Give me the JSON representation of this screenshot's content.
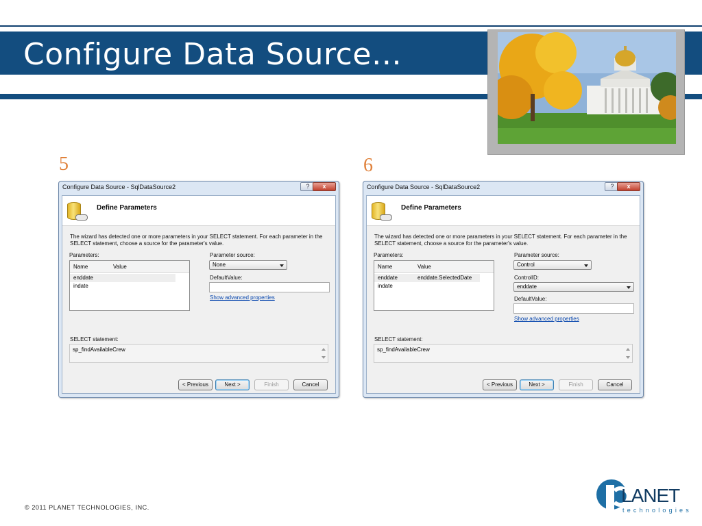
{
  "slide": {
    "title": "Configure Data Source…",
    "footer": "© 2011 PLANET TECHNOLOGIES, INC.",
    "logo": {
      "word": "LANET",
      "sub": "technologies"
    },
    "photo_icon": "photo-capitol-building"
  },
  "steps": [
    {
      "number": "5",
      "dialog": {
        "title": "Configure Data Source - SqlDataSource2",
        "help": "?",
        "close": "x",
        "heading": "Define Parameters",
        "description": "The wizard has detected one or more parameters in your SELECT statement. For each parameter in the SELECT statement, choose a source for the parameter's value.",
        "parameters_label": "Parameters:",
        "columns": [
          "Name",
          "Value"
        ],
        "rows": [
          {
            "name": "enddate",
            "value": ""
          },
          {
            "name": "indate",
            "value": ""
          }
        ],
        "parameter_source_label": "Parameter source:",
        "parameter_source_value": "None",
        "default_value_label": "DefaultValue:",
        "advanced_link": "Show advanced properties",
        "select_label": "SELECT statement:",
        "select_value": "sp_findAvailableCrew",
        "buttons": {
          "previous": "< Previous",
          "next": "Next >",
          "finish": "Finish",
          "cancel": "Cancel"
        }
      }
    },
    {
      "number": "6",
      "dialog": {
        "title": "Configure Data Source - SqlDataSource2",
        "help": "?",
        "close": "x",
        "heading": "Define Parameters",
        "description": "The wizard has detected one or more parameters in your SELECT statement. For each parameter in the SELECT statement, choose a source for the parameter's value.",
        "parameters_label": "Parameters:",
        "columns": [
          "Name",
          "Value"
        ],
        "rows": [
          {
            "name": "enddate",
            "value": "enddate.SelectedDate"
          },
          {
            "name": "indate",
            "value": ""
          }
        ],
        "parameter_source_label": "Parameter source:",
        "parameter_source_value": "Control",
        "control_id_label": "ControlID:",
        "control_id_value": "enddate",
        "default_value_label": "DefaultValue:",
        "advanced_link": "Show advanced properties",
        "select_label": "SELECT statement:",
        "select_value": "sp_findAvailableCrew",
        "buttons": {
          "previous": "< Previous",
          "next": "Next >",
          "finish": "Finish",
          "cancel": "Cancel"
        }
      }
    }
  ],
  "colors": {
    "title_bar": "#134d7f",
    "step_number": "#e0823c",
    "link": "#0645ad"
  }
}
